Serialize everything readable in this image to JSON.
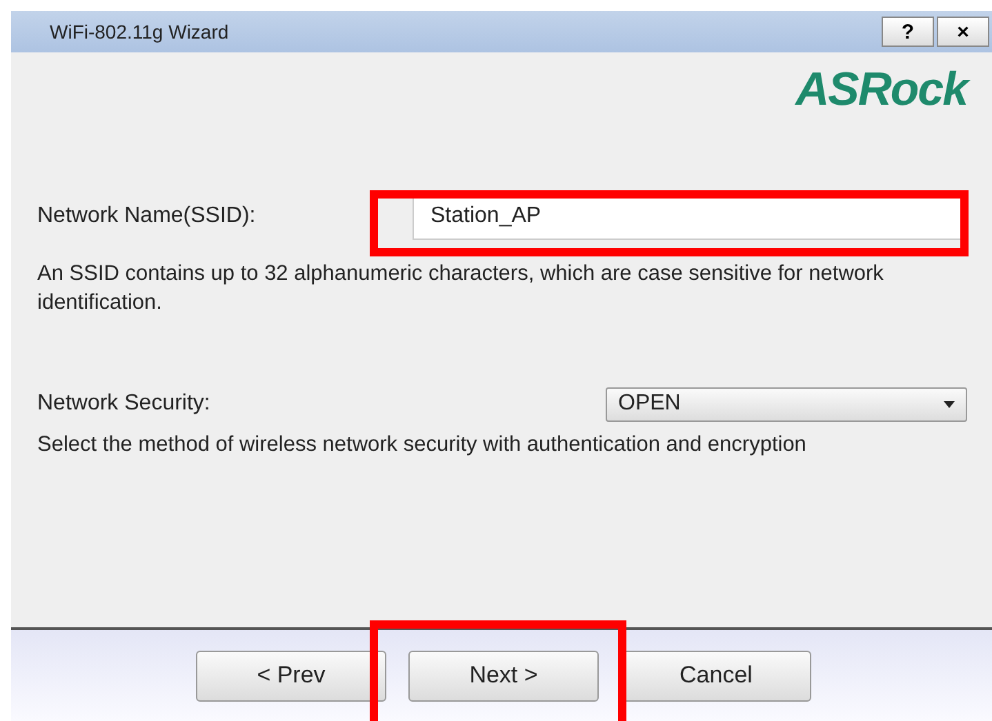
{
  "window": {
    "title": "WiFi-802.11g Wizard",
    "controls": [
      "?",
      "×"
    ]
  },
  "logo": "ASRock",
  "ssid": {
    "label": "Network Name(SSID):",
    "value": "Station_AP",
    "hint": "An SSID contains up to 32 alphanumeric characters, which are case sensitive for network identification."
  },
  "security": {
    "label": "Network Security:",
    "value": "OPEN",
    "hint": "Select the method of wireless network security with authentication and encryption"
  },
  "buttons": [
    "< Prev",
    "Next >",
    "Cancel"
  ]
}
